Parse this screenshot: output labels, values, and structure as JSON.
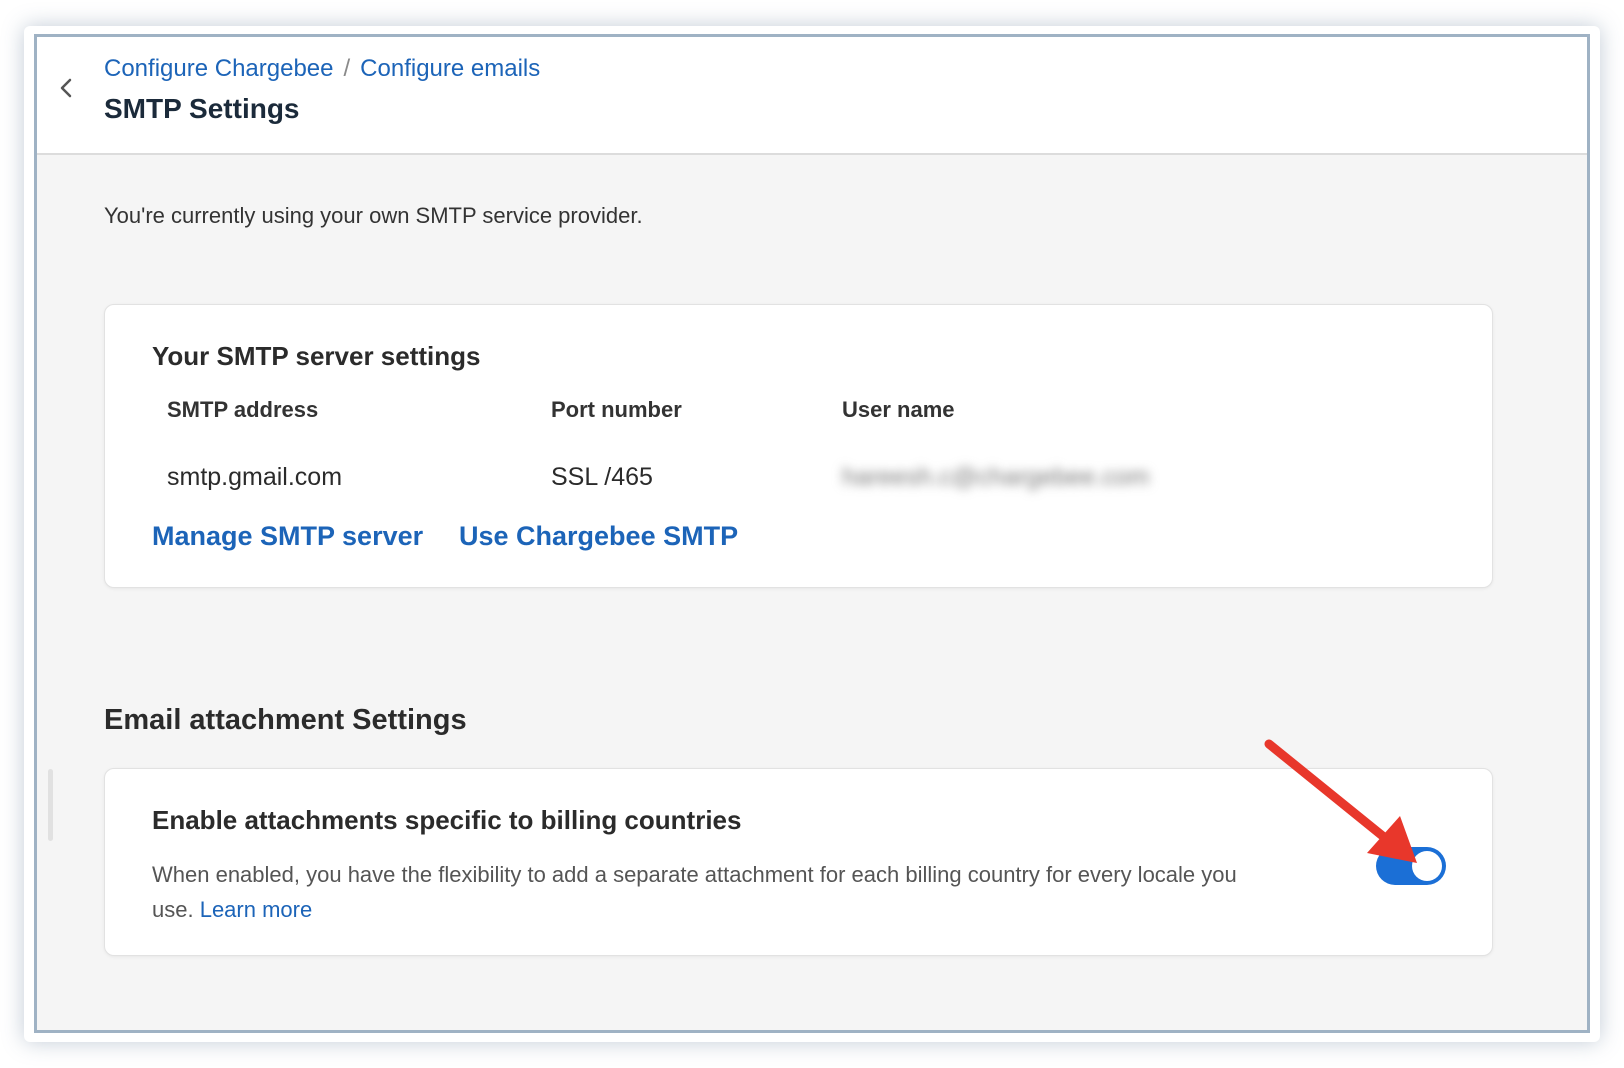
{
  "header": {
    "back_icon": "chevron-left-icon",
    "breadcrumb": [
      {
        "label": "Configure Chargebee"
      },
      {
        "label": "Configure emails"
      }
    ],
    "separator": "/",
    "title": "SMTP Settings"
  },
  "intro_text": "You're currently using your own SMTP service provider.",
  "smtp_card": {
    "title": "Your SMTP server settings",
    "columns": [
      {
        "label": "SMTP address",
        "value": "smtp.gmail.com"
      },
      {
        "label": "Port number",
        "value": "SSL /465"
      },
      {
        "label": "User name",
        "value": "hareesh.c@chargebee.com",
        "redacted": true
      }
    ],
    "links": {
      "manage": "Manage SMTP server",
      "use_chargebee": "Use Chargebee SMTP"
    }
  },
  "attachment_section": {
    "title": "Email attachment Settings",
    "setting": {
      "title": "Enable attachments specific to billing countries",
      "description": "When enabled, you have the flexibility to add a separate attachment for each billing country for every locale you use.",
      "learn_more": "Learn more",
      "enabled": true
    }
  },
  "colors": {
    "link": "#1c64b8",
    "toggle_on": "#1b6fd6",
    "annotation_arrow": "#e8372b",
    "frame_border": "#9fb2c4"
  }
}
